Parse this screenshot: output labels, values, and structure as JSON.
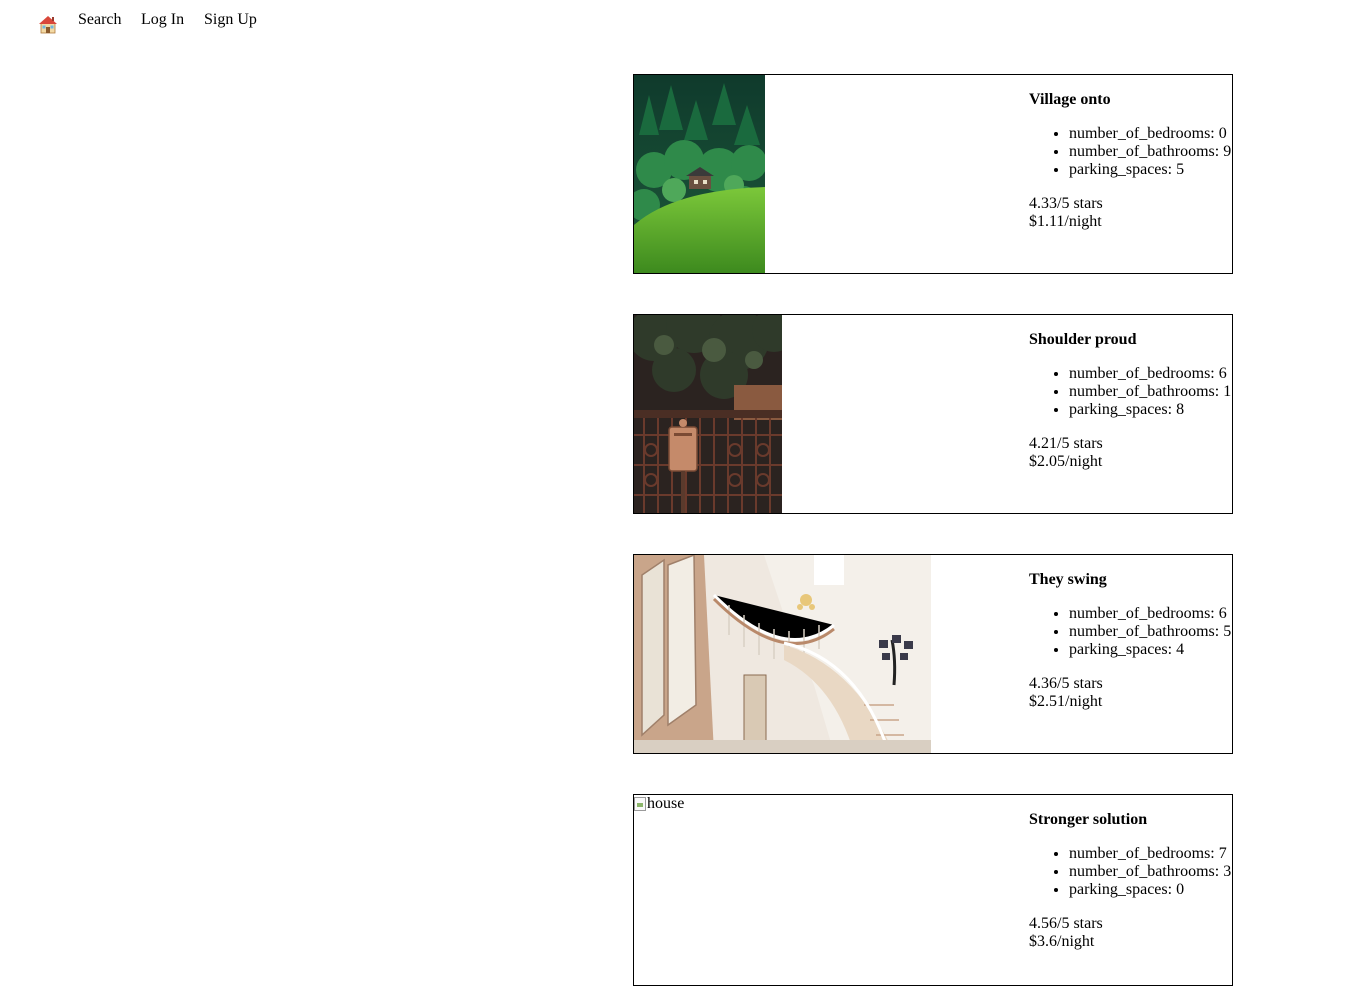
{
  "nav": {
    "home_icon": "house-emoji-icon",
    "home_glyph": "🏠",
    "links": [
      "Search",
      "Log In",
      "Sign Up"
    ]
  },
  "listings": [
    {
      "title": "Village onto",
      "features": [
        "number_of_bedrooms: 0",
        "number_of_bathrooms: 9",
        "parking_spaces: 5"
      ],
      "rating": "4.33/5 stars",
      "price": "$1.11/night",
      "image": "forest-hillside-cabin-photo"
    },
    {
      "title": "Shoulder proud",
      "features": [
        "number_of_bedrooms: 6",
        "number_of_bathrooms: 1",
        "parking_spaces: 8"
      ],
      "rating": "4.21/5 stars",
      "price": "$2.05/night",
      "image": "iron-gate-mailbox-photo"
    },
    {
      "title": "They swing",
      "features": [
        "number_of_bedrooms: 6",
        "number_of_bathrooms: 5",
        "parking_spaces: 4"
      ],
      "rating": "4.36/5 stars",
      "price": "$2.51/night",
      "image": "staircase-interior-photo"
    },
    {
      "title": "Stronger solution",
      "features": [
        "number_of_bedrooms: 7",
        "number_of_bathrooms: 3",
        "parking_spaces: 0"
      ],
      "rating": "4.56/5 stars",
      "price": "$3.6/night",
      "image_alt": "house"
    }
  ]
}
